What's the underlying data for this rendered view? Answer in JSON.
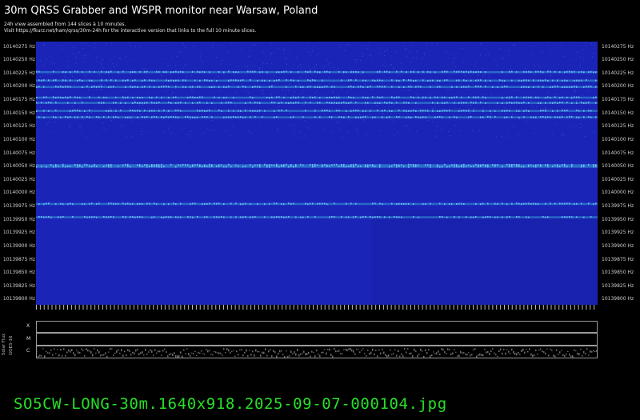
{
  "header": {
    "title": "30m QRSS Grabber and WSPR monitor near Warsaw, Poland",
    "line1": "24h view assembled from 144 slices à 10 minutes.",
    "line2": "Visit https://fkurz.net/ham/qrss/30m-24h for the interactive version that links to the full 10 minute slices."
  },
  "chart_data": {
    "type": "heatmap",
    "title": "30m QRSS Grabber and WSPR monitor near Warsaw, Poland",
    "ylabel": "Hz",
    "y_ticks": [
      "10140275 Hz",
      "10140250 Hz",
      "10140225 Hz",
      "10140200 Hz",
      "10140175 Hz",
      "10140150 Hz",
      "10140125 Hz",
      "10140100 Hz",
      "10140075 Hz",
      "10140050 Hz",
      "10140025 Hz",
      "10140000 Hz",
      "10139975 Hz",
      "10139950 Hz",
      "10139925 Hz",
      "10139900 Hz",
      "10139875 Hz",
      "10139850 Hz",
      "10139825 Hz",
      "10139800 Hz"
    ],
    "ylim": [
      10139790,
      10140285
    ],
    "slices": 144,
    "slice_minutes": 10,
    "signal_bands_hz": [
      10140228,
      10140212,
      10140200,
      10140180,
      10140170,
      10140155,
      10140143,
      10140053,
      10140050,
      10139980,
      10139955
    ],
    "colors": {
      "background": "#1a25b8",
      "signal": "#3aa0d8"
    }
  },
  "solar": {
    "title": "Solar Flux",
    "subtitle": "GOES-16",
    "classes": [
      "X",
      "M",
      "C"
    ]
  },
  "footer": {
    "filename": "SO5CW-LONG-30m.1640x918.2025-09-07-000104.jpg"
  }
}
